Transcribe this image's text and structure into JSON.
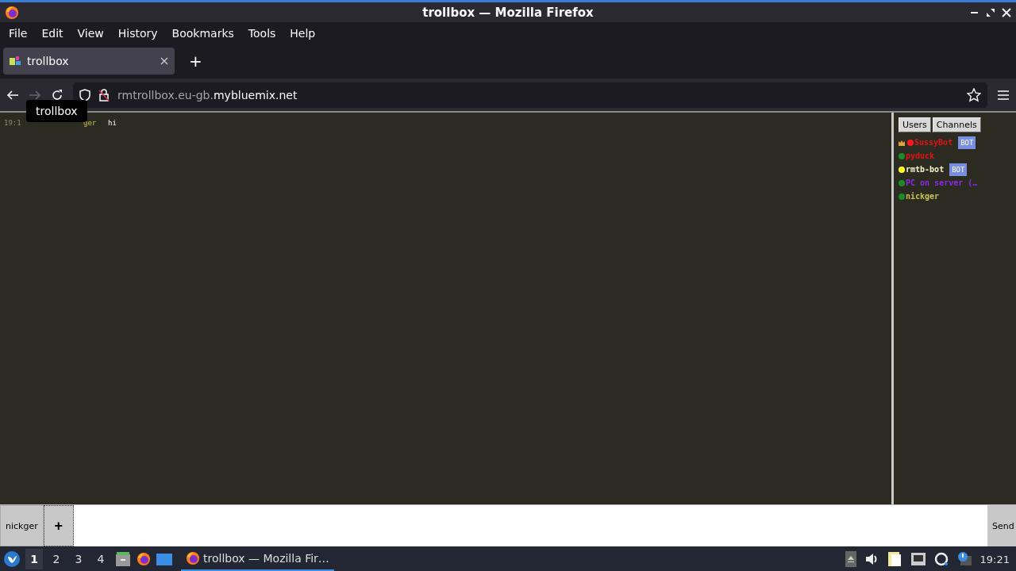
{
  "window": {
    "title": "trollbox — Mozilla Firefox"
  },
  "menu": [
    "File",
    "Edit",
    "View",
    "History",
    "Bookmarks",
    "Tools",
    "Help"
  ],
  "tabs": [
    {
      "label": "trollbox",
      "selected": true
    }
  ],
  "new_tab": "+",
  "address": {
    "host_prefix": "rmtrollbox.eu-gb.",
    "host_domain": "mybluemix.net"
  },
  "tooltip": "trollbox",
  "messages": [
    {
      "time": "19:1",
      "nick": "ger",
      "text": "hi"
    }
  ],
  "sidebar": {
    "tabs": [
      "Users",
      "Channels"
    ],
    "users": [
      {
        "name": {
          "text": "SussyBot",
          "color": "#e01515"
        },
        "color": "#ff1a1a",
        "badge": "BOT",
        "crown": true
      },
      {
        "name": {
          "text": "pyduck",
          "color": "#e01515"
        },
        "color": "#1c8c2a",
        "crown": false
      },
      {
        "name": {
          "text": "rmtb-bot",
          "color": "#f4f2c8"
        },
        "color": "#ffff20",
        "badge": "BOT",
        "crown": false
      },
      {
        "name": {
          "text": "PC on server (…",
          "color": "#8a2be2"
        },
        "color": "#1c8c2a",
        "crown": false
      },
      {
        "name": {
          "text": "nickger",
          "color": "#c8c050"
        },
        "color": "#1c8c2a",
        "crown": false
      }
    ]
  },
  "composer": {
    "nick": "nickger",
    "add": "+",
    "send": "Send"
  },
  "taskbar": {
    "workspaces": [
      {
        "label": "1",
        "selected": true
      },
      {
        "label": "2",
        "selected": false
      },
      {
        "label": "3",
        "selected": false
      },
      {
        "label": "4",
        "selected": false
      }
    ],
    "task": "trollbox — Mozilla Fir…",
    "clock": "19:21"
  }
}
